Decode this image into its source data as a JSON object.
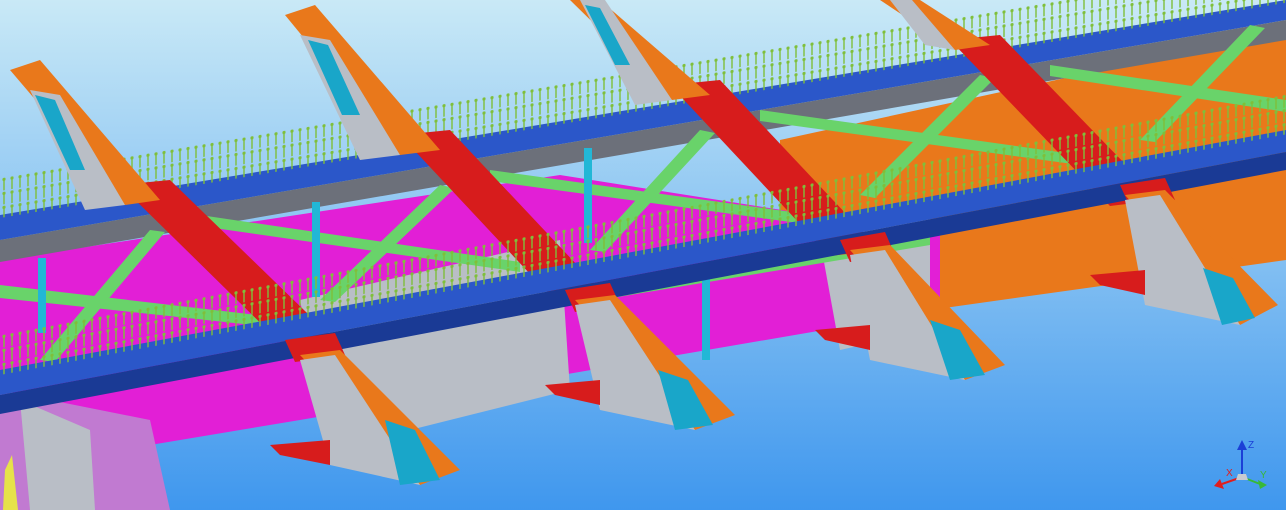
{
  "viewport": {
    "background_top": "#c9e9f6",
    "background_bottom": "#3f97ee"
  },
  "colors": {
    "deck_blue": "#2b57c9",
    "deck_blue_dark": "#1a3a95",
    "stud_green": "#7fbf3a",
    "girder_orange": "#e9781b",
    "girder_orange_dark": "#b9560f",
    "web_grey": "#b9bec6",
    "web_grey_dark": "#8d939b",
    "crossbeam_red": "#d71c1c",
    "brace_green": "#69d36a",
    "box_magenta": "#e21fd6",
    "end_cyan": "#19a6c9",
    "post_cyan": "#22b7d6"
  },
  "icons": {
    "axis_triad": "axis-triad-icon"
  },
  "axis_triad": {
    "z_label": "Z",
    "x_label": "X",
    "y_label": "Y",
    "z_color": "#1b3fd6",
    "x_color": "#e01d1d",
    "y_color": "#38b938"
  }
}
